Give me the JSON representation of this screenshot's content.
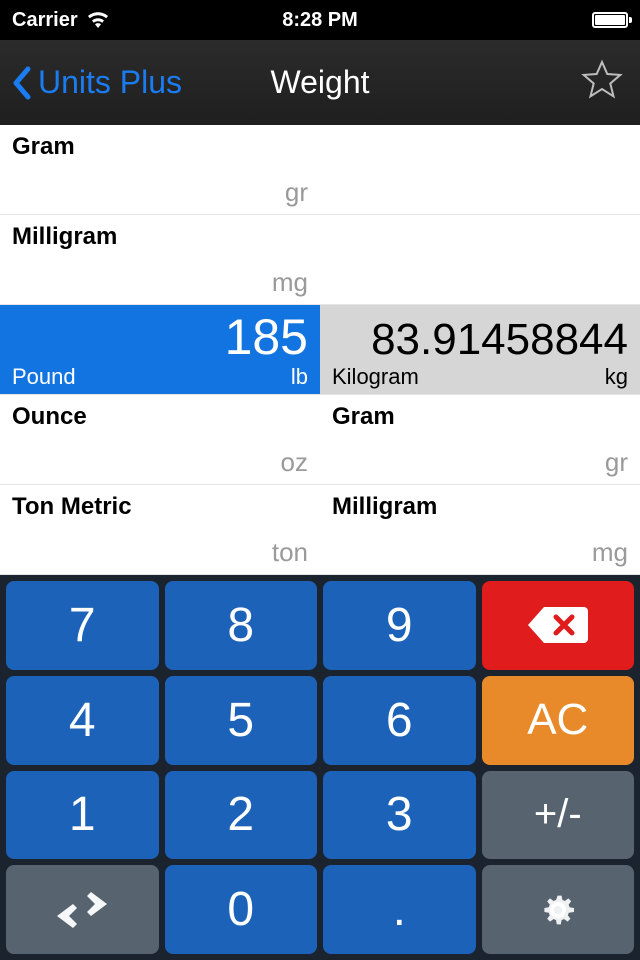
{
  "status": {
    "carrier": "Carrier",
    "time": "8:28 PM"
  },
  "nav": {
    "back": "Units Plus",
    "title": "Weight"
  },
  "left_units": [
    {
      "name": "Gram",
      "abbr": "gr"
    },
    {
      "name": "Milligram",
      "abbr": "mg"
    },
    {
      "name": "Pound",
      "abbr": "lb",
      "value": "185"
    },
    {
      "name": "Ounce",
      "abbr": "oz"
    },
    {
      "name": "Ton Metric",
      "abbr": "ton"
    }
  ],
  "right_units": [
    {
      "name": "",
      "abbr": ""
    },
    {
      "name": "",
      "abbr": ""
    },
    {
      "name": "Kilogram",
      "abbr": "kg",
      "value": "83.91458844"
    },
    {
      "name": "Gram",
      "abbr": "gr"
    },
    {
      "name": "Milligram",
      "abbr": "mg"
    }
  ],
  "keypad": {
    "k7": "7",
    "k8": "8",
    "k9": "9",
    "k4": "4",
    "k5": "5",
    "k6": "6",
    "ac": "AC",
    "k1": "1",
    "k2": "2",
    "k3": "3",
    "pm": "+/-",
    "k0": "0",
    "dot": "."
  }
}
